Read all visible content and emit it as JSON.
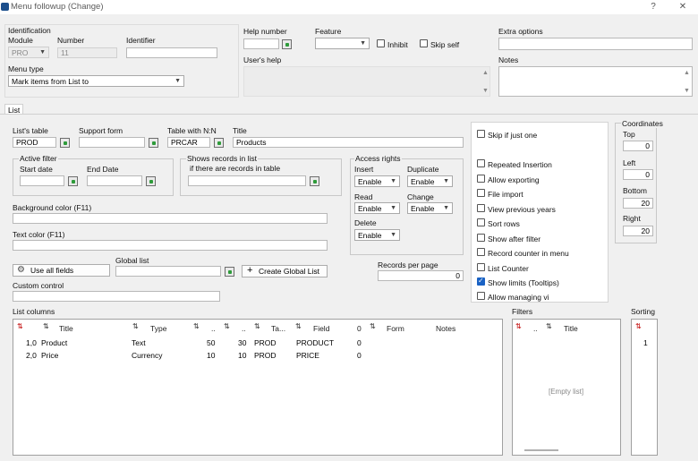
{
  "window": {
    "title": "Menu followup (Change)",
    "help": "?",
    "close": "✕"
  },
  "identification": {
    "group_label": "Identification",
    "module_label": "Module",
    "module_value": "PRO",
    "number_label": "Number",
    "number_value": "11",
    "identifier_label": "Identifier",
    "identifier_value": "",
    "menu_type_label": "Menu type",
    "menu_type_value": "Mark items from List to"
  },
  "help": {
    "help_number_label": "Help number",
    "feature_label": "Feature",
    "inhibit_label": "Inhibit",
    "skip_self_label": "Skip self",
    "users_help_label": "User's help"
  },
  "extra": {
    "extra_options_label": "Extra options",
    "notes_label": "Notes"
  },
  "tab": {
    "label": "List"
  },
  "list": {
    "lists_table_label": "List's table",
    "lists_table_value": "PROD",
    "support_form_label": "Support form",
    "support_form_value": "",
    "table_nn_label": "Table with N:N",
    "table_nn_value": "PRCAR",
    "title_label": "Title",
    "title_value": "Products",
    "active_filter_label": "Active filter",
    "start_date_label": "Start date",
    "end_date_label": "End Date",
    "shows_records_label": "Shows records in list",
    "if_records_label": "if there are records in table",
    "bg_color_label": "Background color (F11)",
    "text_color_label": "Text color (F11)",
    "use_all_fields_label": "Use all fields",
    "global_list_label": "Global list",
    "create_global_list_label": "Create Global List",
    "custom_control_label": "Custom control",
    "records_per_page_label": "Records per page",
    "records_per_page_value": "0"
  },
  "access": {
    "label": "Access rights",
    "insert_label": "Insert",
    "duplicate_label": "Duplicate",
    "read_label": "Read",
    "change_label": "Change",
    "delete_label": "Delete",
    "insert_value": "Enable",
    "duplicate_value": "Enable",
    "read_value": "Enable",
    "change_value": "Enable",
    "delete_value": "Enable"
  },
  "options": {
    "skip_if_just_one": "Skip if just one",
    "repeated_insertion": "Repeated Insertion",
    "allow_exporting": "Allow exporting",
    "file_import": "File import",
    "view_previous_years": "View previous years",
    "sort_rows": "Sort rows",
    "show_after_filter": "Show after filter",
    "record_counter_in_menu": "Record counter in menu",
    "list_counter": "List Counter",
    "show_limits": "Show limits (Tooltips)",
    "allow_managing": "Allow managing vi"
  },
  "coordinates": {
    "label": "Coordinates",
    "top_label": "Top",
    "top": "0",
    "left_label": "Left",
    "left": "0",
    "bottom_label": "Bottom",
    "bottom": "20",
    "right_label": "Right",
    "right": "20"
  },
  "columns": {
    "label": "List columns",
    "headers": {
      "title": "Title",
      "type": "Type",
      "dot": "..",
      "ta": "Ta...",
      "field": "Field",
      "zero": "0",
      "form": "Form",
      "notes": "Notes"
    },
    "rows": [
      {
        "num": "1,0",
        "title": "Product",
        "type": "Text",
        "a": "50",
        "b": "30",
        "table": "PROD",
        "field": "PRODUCT",
        "z": "0"
      },
      {
        "num": "2,0",
        "title": "Price",
        "type": "Currency",
        "a": "10",
        "b": "10",
        "table": "PROD",
        "field": "PRICE",
        "z": "0"
      }
    ]
  },
  "filters": {
    "label": "Filters",
    "dot": "..",
    "title": "Title",
    "empty": "[Empty list]"
  },
  "sorting": {
    "label": "Sorting",
    "value": "1"
  },
  "icons": {
    "sort": "sort-icon",
    "gear": "gear-icon",
    "plus": "plus-icon",
    "picker": "picker-icon"
  }
}
